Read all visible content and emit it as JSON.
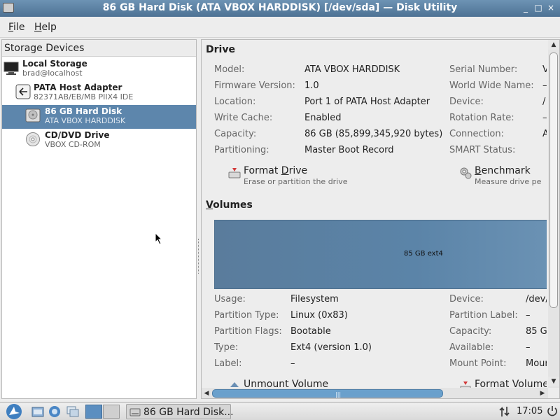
{
  "window": {
    "title": "86 GB Hard Disk (ATA VBOX HARDDISK) [/dev/sda] — Disk Utility",
    "controls": {
      "minimize": "_",
      "maximize": "□",
      "close": "×"
    }
  },
  "menubar": {
    "file": {
      "accel": "F",
      "rest": "ile"
    },
    "help": {
      "accel": "H",
      "rest": "elp"
    }
  },
  "storage": {
    "header": "Storage Devices",
    "devices": [
      {
        "name": "Local Storage",
        "sub": "brad@localhost",
        "icon": "computer-icon"
      },
      {
        "name": "PATA Host Adapter",
        "sub": "82371AB/EB/MB PIIX4 IDE",
        "icon": "adapter-icon"
      },
      {
        "name": "86 GB Hard Disk",
        "sub": "ATA VBOX HARDDISK",
        "icon": "harddisk-icon",
        "selected": true
      },
      {
        "name": "CD/DVD Drive",
        "sub": "VBOX CD-ROM",
        "icon": "cdrom-icon"
      }
    ]
  },
  "drive": {
    "title": "Drive",
    "left_fields": [
      {
        "key": "Model:",
        "value": "ATA VBOX HARDDISK"
      },
      {
        "key": "Firmware Version:",
        "value": "1.0"
      },
      {
        "key": "Location:",
        "value": "Port 1 of PATA Host Adapter"
      },
      {
        "key": "Write Cache:",
        "value": "Enabled"
      },
      {
        "key": "Capacity:",
        "value": "86 GB (85,899,345,920 bytes)"
      },
      {
        "key": "Partitioning:",
        "value": "Master Boot Record"
      }
    ],
    "right_fields": [
      {
        "key": "Serial Number:",
        "value": "V"
      },
      {
        "key": "World Wide Name:",
        "value": "–"
      },
      {
        "key": "Device:",
        "value": "/"
      },
      {
        "key": "Rotation Rate:",
        "value": "–"
      },
      {
        "key": "Connection:",
        "value": "A"
      },
      {
        "key": "SMART Status:",
        "value": ""
      }
    ],
    "actions": [
      {
        "name_accel": "Format ",
        "name_u": "D",
        "name_rest": "rive",
        "desc": "Erase or partition the drive"
      },
      {
        "name_accel": "",
        "name_u": "B",
        "name_rest": "enchmark",
        "desc": "Measure drive pe"
      }
    ]
  },
  "volumes": {
    "title_u": "V",
    "title_rest": "olumes",
    "bar_label": "85 GB ext4",
    "left_fields": [
      {
        "key": "Usage:",
        "value": "Filesystem"
      },
      {
        "key": "Partition Type:",
        "value": "Linux (0x83)"
      },
      {
        "key": "Partition Flags:",
        "value": "Bootable"
      },
      {
        "key": "Type:",
        "value": "Ext4 (version 1.0)"
      },
      {
        "key": "Label:",
        "value": "–"
      }
    ],
    "right_fields": [
      {
        "key": "Device:",
        "value": "/dev/"
      },
      {
        "key": "Partition Label:",
        "value": "–"
      },
      {
        "key": "Capacity:",
        "value": "85 G"
      },
      {
        "key": "Available:",
        "value": "–"
      },
      {
        "key": "Mount Point:",
        "value": "Mour"
      }
    ],
    "actions": [
      {
        "name": "Unmount Volume"
      },
      {
        "name": "Format Volume"
      }
    ]
  },
  "taskbar": {
    "task_label": "86 GB Hard Disk...",
    "clock": "17:05"
  },
  "colors": {
    "selection": "#5d86ac",
    "volume_bar": "#5b84a8",
    "titlebar": "#5a80a2"
  }
}
